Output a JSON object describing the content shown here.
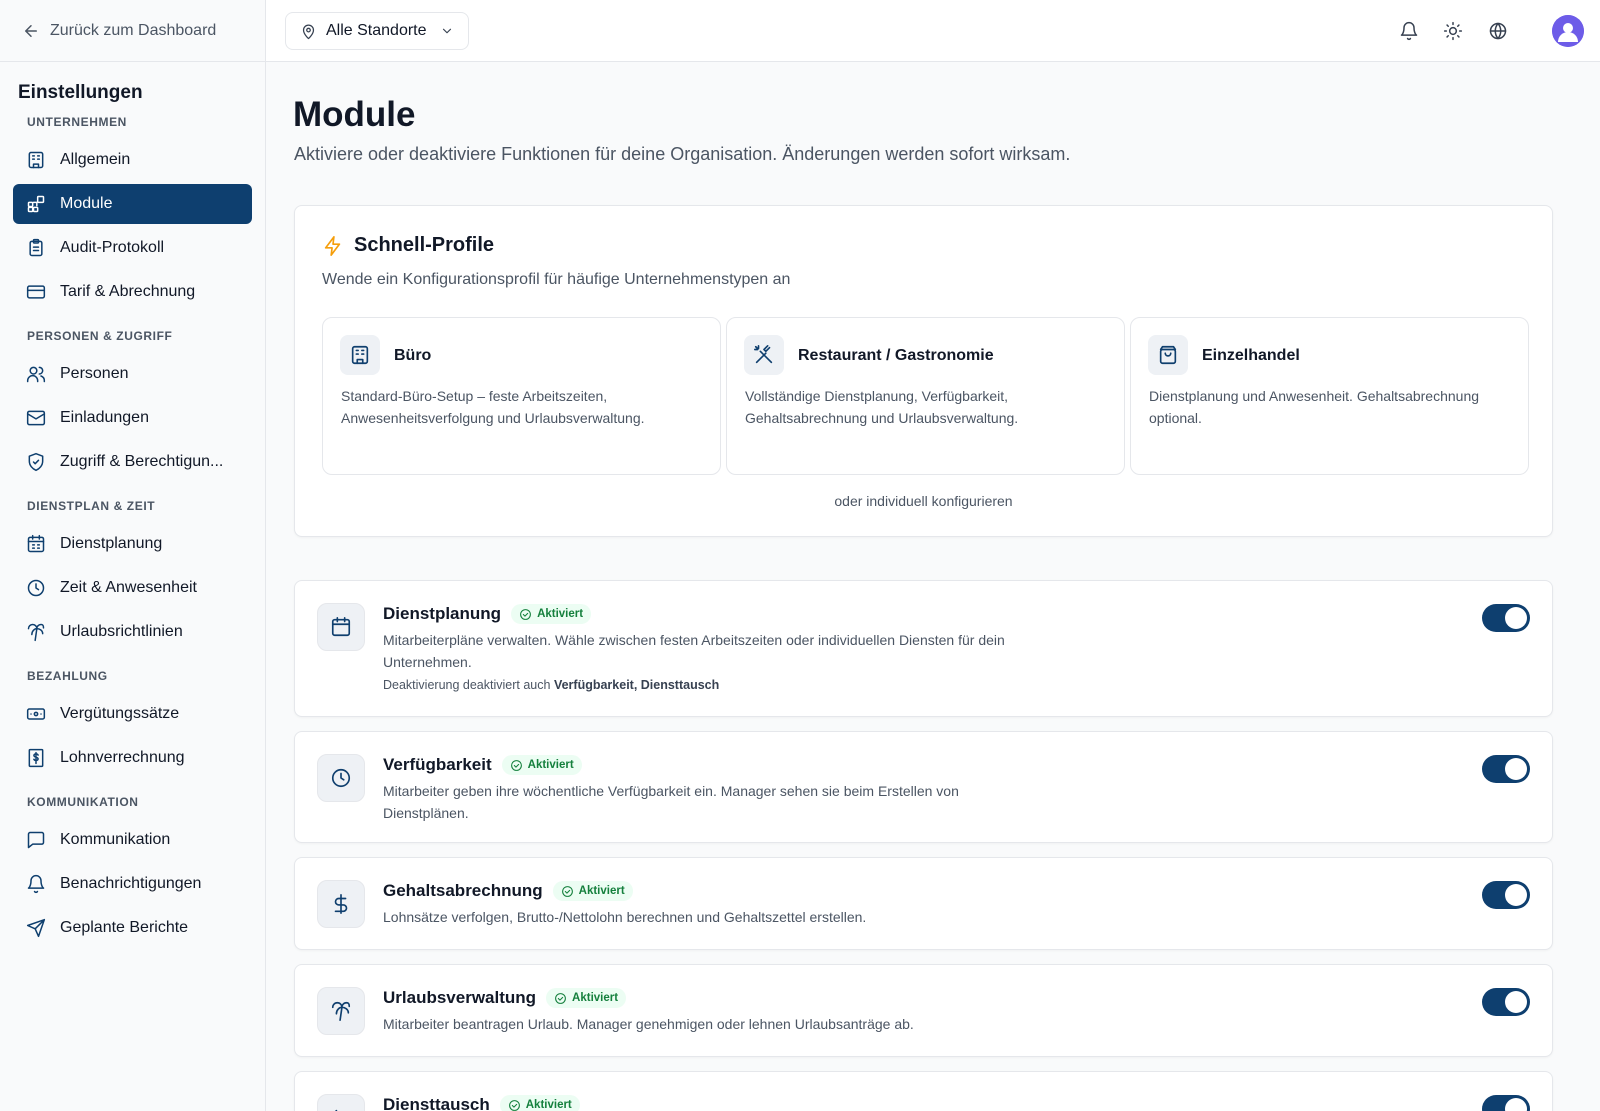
{
  "back_link": {
    "label": "Zurück zum Dashboard"
  },
  "sidebar": {
    "title": "Einstellungen",
    "sections": [
      {
        "label": "UNTERNEHMEN",
        "items": [
          {
            "label": "Allgemein",
            "icon": "building-icon"
          },
          {
            "label": "Module",
            "icon": "modules-icon",
            "active": true
          },
          {
            "label": "Audit-Protokoll",
            "icon": "clipboard-icon"
          },
          {
            "label": "Tarif & Abrechnung",
            "icon": "credit-card-icon"
          }
        ]
      },
      {
        "label": "PERSONEN & ZUGRIFF",
        "items": [
          {
            "label": "Personen",
            "icon": "users-icon"
          },
          {
            "label": "Einladungen",
            "icon": "mail-icon"
          },
          {
            "label": "Zugriff & Berechtigun...",
            "icon": "shield-check-icon"
          }
        ]
      },
      {
        "label": "DIENSTPLAN & ZEIT",
        "items": [
          {
            "label": "Dienstplanung",
            "icon": "calendar-icon"
          },
          {
            "label": "Zeit & Anwesenheit",
            "icon": "clock-icon"
          },
          {
            "label": "Urlaubsrichtlinien",
            "icon": "palm-tree-icon"
          }
        ]
      },
      {
        "label": "BEZAHLUNG",
        "items": [
          {
            "label": "Vergütungssätze",
            "icon": "banknote-icon"
          },
          {
            "label": "Lohnverrechnung",
            "icon": "receipt-dollar-icon"
          }
        ]
      },
      {
        "label": "KOMMUNIKATION",
        "items": [
          {
            "label": "Kommunikation",
            "icon": "message-square-icon"
          },
          {
            "label": "Benachrichtigungen",
            "icon": "bell-icon"
          },
          {
            "label": "Geplante Berichte",
            "icon": "send-icon"
          }
        ]
      }
    ]
  },
  "topbar": {
    "location": "Alle Standorte"
  },
  "page": {
    "title": "Module",
    "subtitle": "Aktiviere oder deaktiviere Funktionen für deine Organisation. Änderungen werden sofort wirksam."
  },
  "quick_profiles": {
    "title": "Schnell-Profile",
    "subtitle": "Wende ein Konfigurationsprofil für häufige Unternehmenstypen an",
    "profiles": [
      {
        "title": "Büro",
        "icon": "building-icon",
        "description": "Standard-Büro-Setup – feste Arbeitszeiten, Anwesenheitsverfolgung und Urlaubsverwaltung."
      },
      {
        "title": "Restaurant / Gastronomie",
        "icon": "utensils-crossed-icon",
        "description": "Vollständige Dienstplanung, Verfügbarkeit, Gehaltsabrechnung und Urlaubsverwaltung."
      },
      {
        "title": "Einzelhandel",
        "icon": "shopping-bag-icon",
        "description": "Dienstplanung und Anwesenheit. Gehaltsabrechnung optional."
      }
    ],
    "footer": "oder individuell konfigurieren"
  },
  "modules": [
    {
      "title": "Dienstplanung",
      "icon": "calendar-icon",
      "status": "Aktiviert",
      "enabled": true,
      "description": "Mitarbeiterpläne verwalten. Wähle zwischen festen Arbeitszeiten oder individuellen Diensten für dein Unternehmen.",
      "note_prefix": "Deaktivierung deaktiviert auch",
      "note_items": "Verfügbarkeit, Diensttausch"
    },
    {
      "title": "Verfügbarkeit",
      "icon": "clock-icon",
      "status": "Aktiviert",
      "enabled": true,
      "description": "Mitarbeiter geben ihre wöchentliche Verfügbarkeit ein. Manager sehen sie beim Erstellen von Dienstplänen."
    },
    {
      "title": "Gehaltsabrechnung",
      "icon": "dollar-icon",
      "status": "Aktiviert",
      "enabled": true,
      "description": "Lohnsätze verfolgen, Brutto-/Nettolohn berechnen und Gehaltszettel erstellen."
    },
    {
      "title": "Urlaubsverwaltung",
      "icon": "palm-tree-icon",
      "status": "Aktiviert",
      "enabled": true,
      "description": "Mitarbeiter beantragen Urlaub. Manager genehmigen oder lehnen Urlaubsanträge ab."
    },
    {
      "title": "Diensttausch",
      "icon": "swap-icon",
      "status": "Aktiviert",
      "enabled": true
    }
  ],
  "colors": {
    "primary": "#0e3f6f",
    "success": "#15803d",
    "accent": "#f59e0b"
  }
}
